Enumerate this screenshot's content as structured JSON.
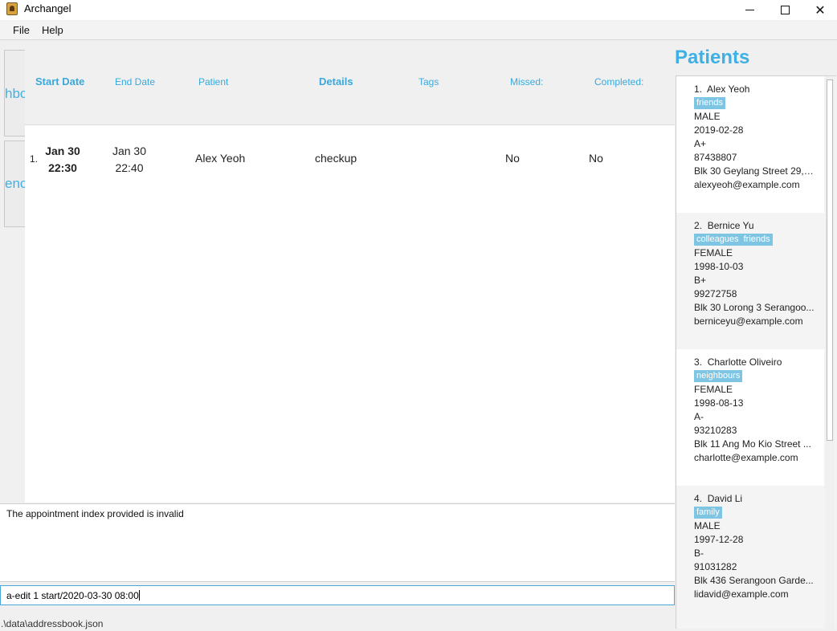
{
  "window": {
    "title": "Archangel"
  },
  "menu": {
    "file": "File",
    "help": "Help"
  },
  "side_tabs": [
    "hbc",
    "enc"
  ],
  "appointments": {
    "headers": {
      "start_date": "Start Date",
      "end_date": "End Date",
      "patient": "Patient",
      "details": "Details",
      "tags": "Tags",
      "missed": "Missed:",
      "completed": "Completed:"
    },
    "rows": [
      {
        "index": "1.",
        "start_date": "Jan 30",
        "start_time": "22:30",
        "end_date": "Jan 30",
        "end_time": "22:40",
        "patient": "Alex Yeoh",
        "details": "checkup",
        "missed": "No",
        "completed": "No"
      }
    ]
  },
  "result_display": "The appointment index provided is invalid",
  "command_box": {
    "value": "a-edit 1 start/2020-03-30 08:00"
  },
  "status_bar": ".\\data\\addressbook.json",
  "patients": {
    "title": "Patients",
    "items": [
      {
        "index": "1.",
        "name": "Alex Yeoh",
        "tags": [
          "friends"
        ],
        "gender": "MALE",
        "dob": "2019-02-28",
        "blood": "A+",
        "phone": "87438807",
        "address": "Blk 30 Geylang Street 29, ...",
        "email": "alexyeoh@example.com"
      },
      {
        "index": "2.",
        "name": "Bernice Yu",
        "tags": [
          "colleagues",
          "friends"
        ],
        "gender": "FEMALE",
        "dob": "1998-10-03",
        "blood": "B+",
        "phone": "99272758",
        "address": "Blk 30 Lorong 3 Serangoo...",
        "email": "berniceyu@example.com"
      },
      {
        "index": "3.",
        "name": "Charlotte Oliveiro",
        "tags": [
          "neighbours"
        ],
        "gender": "FEMALE",
        "dob": "1998-08-13",
        "blood": "A-",
        "phone": "93210283",
        "address": "Blk 11 Ang Mo Kio Street ...",
        "email": "charlotte@example.com"
      },
      {
        "index": "4.",
        "name": "David Li",
        "tags": [
          "family"
        ],
        "gender": "MALE",
        "dob": "1997-12-28",
        "blood": "B-",
        "phone": "91031282",
        "address": "Blk 436 Serangoon Garde...",
        "email": "lidavid@example.com"
      }
    ]
  },
  "colors": {
    "accent": "#3fb0e6",
    "tag": "#7ec5e3"
  }
}
